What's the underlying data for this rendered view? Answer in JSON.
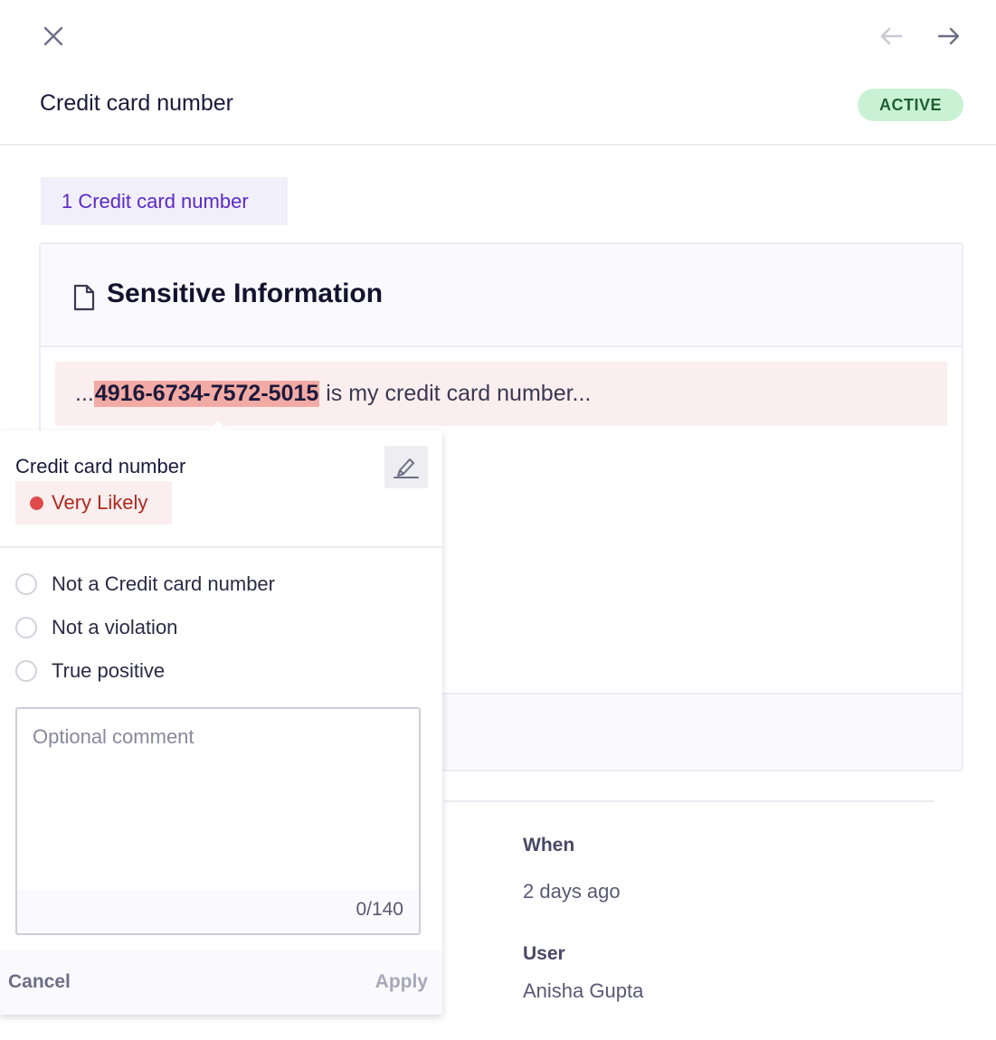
{
  "nav": {
    "close_icon": "close-icon",
    "prev_icon": "arrow-left-icon",
    "next_icon": "arrow-right-icon"
  },
  "header": {
    "title": "Credit card number",
    "status": "ACTIVE"
  },
  "type_tab": {
    "label": "1 Credit card number"
  },
  "card": {
    "title": "Sensitive Information",
    "snippet_prefix": "...",
    "snippet_match": "4916-6734-7572-5015",
    "snippet_suffix": " is my credit card number..."
  },
  "meta": {
    "when_label": "When",
    "when_value": "2 days ago",
    "user_label": "User",
    "user_value": "Anisha Gupta"
  },
  "popover": {
    "title": "Credit card number",
    "likelihood": "Very Likely",
    "options": [
      {
        "label": "Not a Credit card number",
        "selected": false
      },
      {
        "label": "Not a violation",
        "selected": false
      },
      {
        "label": "True positive",
        "selected": false
      }
    ],
    "comment_placeholder": "Optional comment",
    "char_count": "0/140",
    "cancel_label": "Cancel",
    "apply_label": "Apply"
  },
  "colors": {
    "accent": "#5b29c8",
    "active_badge_bg": "#c9f2d4",
    "active_badge_text": "#1f5f33",
    "match_highlight": "#f2aaa4",
    "likelihood_dot": "#de4b4b"
  }
}
